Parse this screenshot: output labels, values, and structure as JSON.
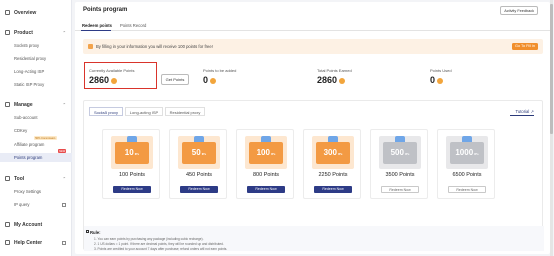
{
  "sidebar": {
    "overview": "Overview",
    "product": "Product",
    "product_items": [
      "Socks5 proxy",
      "Residential proxy",
      "Long-Acting ISP",
      "Static ISP Proxy"
    ],
    "manage": "Manage",
    "manage_items": [
      "Sub-account",
      "CDKey",
      "Affiliate program",
      "Points program"
    ],
    "affiliate_tag": "50% Commission",
    "points_tag": "NEW",
    "tool": "Tool",
    "tool_items": [
      "Proxy Settings",
      "IP query"
    ],
    "my_account": "My Account",
    "help_center": "Help Center"
  },
  "header": {
    "title": "Points program",
    "feedback": "Activity Feedback",
    "tabs": [
      "Redeem points",
      "Points Record"
    ]
  },
  "banner": {
    "text": "By filling in your information you will receive 100 points for free!",
    "button": "Go To Fill in"
  },
  "stats": {
    "available_label": "Currently Available Points",
    "available_value": "2860",
    "get_points": "Get Points",
    "to_be_added_label": "Points to be added",
    "to_be_added_value": "0",
    "total_earned_label": "Total Points Earned",
    "total_earned_value": "2860",
    "used_label": "Points Used",
    "used_value": "0"
  },
  "product_tabs": [
    "Socks5 proxy",
    "Long-acting ISP",
    "Residential proxy"
  ],
  "tutorial": "Tutorial",
  "cards": [
    {
      "amount": "10",
      "unit": "IPs",
      "points": "100 Points",
      "button": "Redeem Now",
      "enabled": true
    },
    {
      "amount": "50",
      "unit": "IPs",
      "points": "450 Points",
      "button": "Redeem Now",
      "enabled": true
    },
    {
      "amount": "100",
      "unit": "IPs",
      "points": "800 Points",
      "button": "Redeem Now",
      "enabled": true
    },
    {
      "amount": "300",
      "unit": "IPs",
      "points": "2250 Points",
      "button": "Redeem Now",
      "enabled": true
    },
    {
      "amount": "500",
      "unit": "IPs",
      "points": "3500 Points",
      "button": "Redeem Now",
      "enabled": false
    },
    {
      "amount": "1000",
      "unit": "IPs",
      "points": "6500 Points",
      "button": "Redeem Now",
      "enabled": false
    }
  ],
  "rules": {
    "title": "Rule:",
    "lines": [
      "1. You can earn points by purchasing any package (including cubic recharge).",
      "2. 1 US dollars = 1 point. If there are decimal points, they will be rounded up and distributed.",
      "3. Points are credited to your account 7 days after purchase; refund orders will not earn points."
    ]
  },
  "colors": {
    "accent": "#2d3b86",
    "orange": "#f18f2c",
    "highlight": "#d9342b"
  }
}
